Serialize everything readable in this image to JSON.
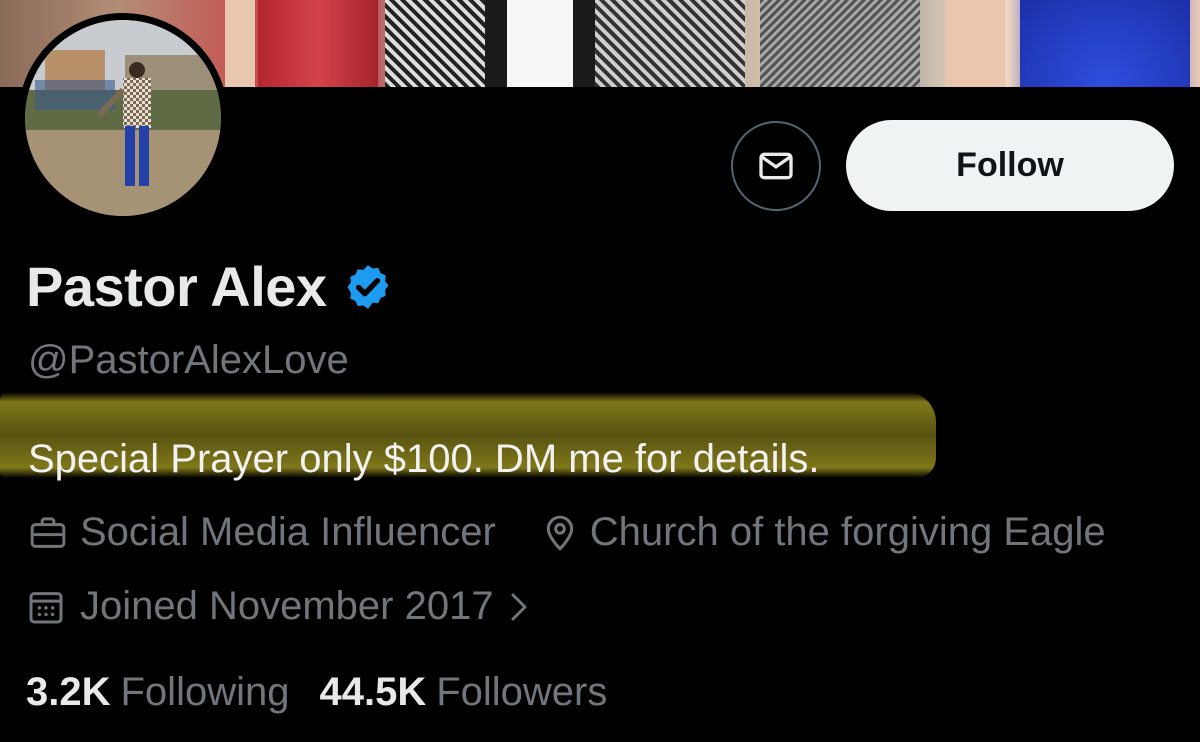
{
  "profile": {
    "display_name": "Pastor Alex",
    "handle": "@PastorAlexLove",
    "bio": "Special Prayer only $100. DM me for details.",
    "occupation": "Social Media Influencer",
    "location": "Church of the forgiving Eagle",
    "joined": "Joined November 2017"
  },
  "actions": {
    "follow_label": "Follow",
    "message_icon": "envelope-icon"
  },
  "stats": {
    "following_count": "3.2K",
    "following_label": "Following",
    "followers_count": "44.5K",
    "followers_label": "Followers"
  },
  "colors": {
    "background": "#000000",
    "primary_text": "#e7e9ea",
    "secondary_text": "#71767b",
    "verified_blue": "#1d9bf0",
    "follow_button_bg": "#eff3f4",
    "highlight": "#968c1e"
  },
  "icons": {
    "verified": "verified-badge-icon",
    "occupation": "briefcase-icon",
    "location": "location-pin-icon",
    "joined": "calendar-icon",
    "expand": "chevron-right-icon"
  }
}
